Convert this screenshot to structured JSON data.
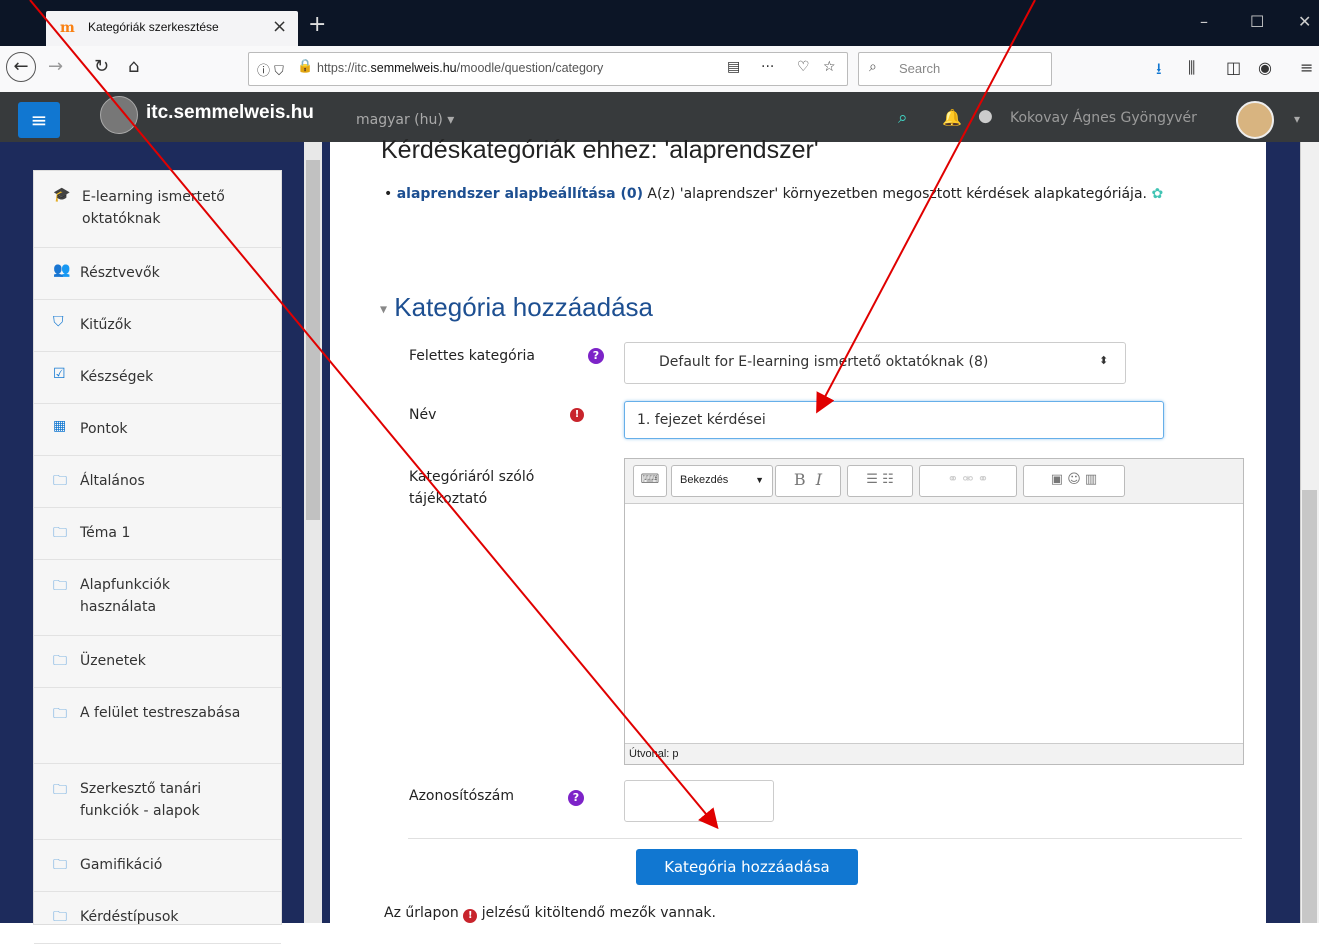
{
  "browser": {
    "tab_title": "Kategóriák szerkesztése",
    "tab_favicon": "m",
    "tab_close": "×",
    "new_tab": "+",
    "url_prefix": "https://itc.",
    "url_host": "semmelweis.hu",
    "url_path": "/moodle/question/category",
    "search_placeholder": "Search",
    "window_minimize": "–",
    "window_maximize": "☐",
    "window_close": "✕"
  },
  "moodle_nav": {
    "site_name": "itc.semmelweis.hu",
    "language": "magyar (hu) ▾",
    "user_name": "Kokovay Ágnes Gyöngyvér",
    "accent_color": "#41d2c2"
  },
  "drawer": {
    "items": [
      {
        "icon": "graduation-cap-icon",
        "glyph": "🎓",
        "label": "E-learning ismertető oktatóknak"
      },
      {
        "icon": "users-icon",
        "glyph": "👥",
        "label": "Résztvevők"
      },
      {
        "icon": "shield-icon",
        "glyph": "⛉",
        "label": "Kitűzők"
      },
      {
        "icon": "checkbox-icon",
        "glyph": "☑",
        "label": "Készségek"
      },
      {
        "icon": "table-icon",
        "glyph": "▦",
        "label": "Pontok"
      },
      {
        "icon": "folder-icon",
        "glyph": "🗀",
        "label": "Általános"
      },
      {
        "icon": "folder-icon",
        "glyph": "🗀",
        "label": "Téma 1"
      },
      {
        "icon": "folder-icon",
        "glyph": "🗀",
        "label": "Alapfunkciók használata"
      },
      {
        "icon": "folder-icon",
        "glyph": "🗀",
        "label": "Üzenetek"
      },
      {
        "icon": "folder-icon",
        "glyph": "🗀",
        "label": "A felület testreszabása"
      },
      {
        "icon": "folder-icon",
        "glyph": "🗀",
        "label": "Szerkesztő tanári funkciók - alapok"
      },
      {
        "icon": "folder-icon",
        "glyph": "🗀",
        "label": "Gamifikáció"
      },
      {
        "icon": "folder-icon",
        "glyph": "🗀",
        "label": "Kérdéstípusok"
      }
    ]
  },
  "main": {
    "heading": "Kérdéskategóriák ehhez: 'alaprendszer'",
    "category_link": "alaprendszer alapbeállítása (0)",
    "category_desc": " A(z) 'alaprendszer' környezetben megosztott kérdések alapkategóriája.",
    "section_title": "Kategória hozzáadása",
    "parent_label": "Felettes kategória",
    "parent_value": "Default for E-learning ismertető oktatóknak (8)",
    "name_label": "Név",
    "name_value": "1. fejezet kérdései",
    "desc_label": "Kategóriáról szóló tájékoztató",
    "editor_paragraph": "Bekezdés",
    "editor_status": "Útvonal: p",
    "id_label": "Azonosítószám",
    "submit_label": "Kategória hozzáadása",
    "footnote_before": "Az űrlapon ",
    "footnote_after": " jelzésű kitöltendő mezők vannak."
  }
}
